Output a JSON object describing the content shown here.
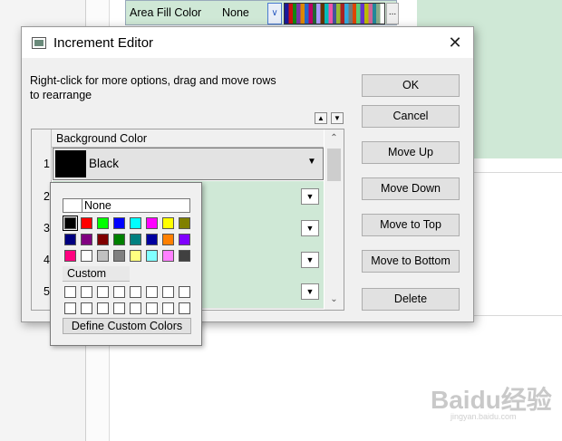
{
  "background_app": {
    "property_label": "Area Fill Color",
    "property_value": "None",
    "dropdown_glyph": "∨",
    "more_glyph": "..."
  },
  "dialog": {
    "title": "Increment Editor",
    "close_glyph": "✕",
    "hint": "Right-click for more options, drag and move rows to  rearrange",
    "buttons": {
      "ok": "OK",
      "cancel": "Cancel",
      "move_up": "Move Up",
      "move_down": "Move Down",
      "move_to_top": "Move to Top",
      "move_to_bottom": "Move to Bottom",
      "delete": "Delete"
    },
    "grid": {
      "header": "Background Color",
      "rows": [
        {
          "num": "1",
          "label": "Black",
          "color": "#000000"
        },
        {
          "num": "2"
        },
        {
          "num": "3"
        },
        {
          "num": "4"
        },
        {
          "num": "5"
        }
      ]
    }
  },
  "color_popup": {
    "none_label": "None",
    "custom_label": "Custom",
    "define_label": "Define Custom Colors",
    "standard_colors": [
      [
        "#000000",
        "#ff0000",
        "#00ff00",
        "#0000ff",
        "#00ffff",
        "#ff00ff",
        "#ffff00",
        "#808000"
      ],
      [
        "#000080",
        "#800080",
        "#800000",
        "#008000",
        "#008080",
        "#0000a0",
        "#ff8000",
        "#8000ff"
      ],
      [
        "#ff0080",
        "#ffffff",
        "#c0c0c0",
        "#808080",
        "#ffff80",
        "#80ffff",
        "#ff80ff",
        "#404040"
      ]
    ],
    "selected_color": "#000000"
  },
  "icons": {
    "up": "▲",
    "down": "▼",
    "scroll_up": "⌃",
    "scroll_down": "⌄"
  },
  "watermark": {
    "text": "Baidu经验",
    "sub": "jingyan.baidu.com"
  },
  "colors": {
    "row_fill": "#cfe8d6",
    "accent": "#4a7bd0"
  }
}
